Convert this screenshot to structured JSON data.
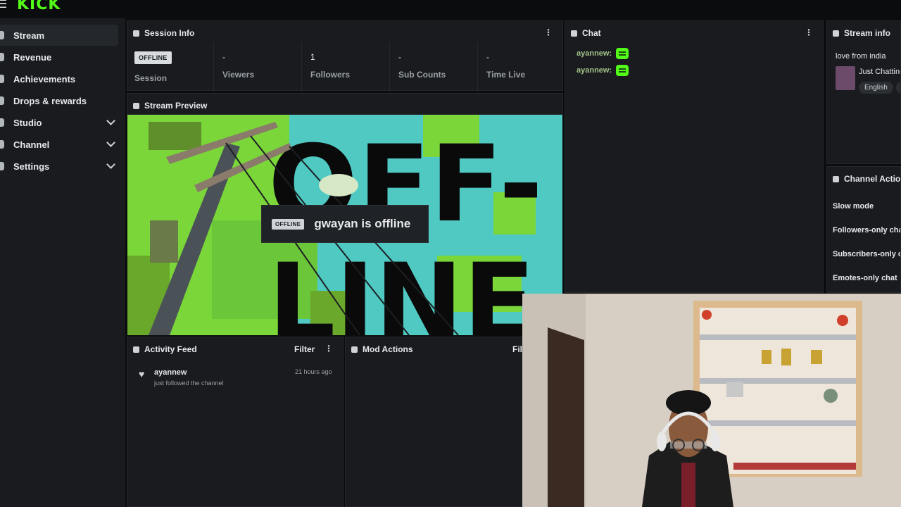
{
  "app": {
    "logo": "KICK"
  },
  "sidebar": {
    "items": [
      {
        "label": "Stream",
        "active": true
      },
      {
        "label": "Revenue"
      },
      {
        "label": "Achievements"
      },
      {
        "label": "Drops & rewards"
      },
      {
        "label": "Studio",
        "expandable": true
      },
      {
        "label": "Channel",
        "expandable": true
      },
      {
        "label": "Settings",
        "expandable": true
      }
    ]
  },
  "session": {
    "title": "Session Info",
    "status_badge": "OFFLINE",
    "session_label": "Session",
    "stats": [
      {
        "value": "-",
        "label": "Viewers"
      },
      {
        "value": "1",
        "label": "Followers"
      },
      {
        "value": "-",
        "label": "Sub Counts"
      },
      {
        "value": "-",
        "label": "Time Live"
      }
    ]
  },
  "preview": {
    "title": "Stream Preview",
    "badge": "OFFLINE",
    "message": "gwayan is offline",
    "bg_word_1": "OFF-",
    "bg_word_2": "LINE"
  },
  "activity": {
    "title": "Activity Feed",
    "filter": "Filter",
    "items": [
      {
        "user": "ayannew",
        "text": "just followed the channel",
        "time": "21 hours ago"
      }
    ]
  },
  "mod": {
    "title": "Mod Actions",
    "filter": "Filter"
  },
  "chat": {
    "title": "Chat",
    "messages": [
      {
        "user": "ayannew:"
      },
      {
        "user": "ayannew:"
      }
    ]
  },
  "stream_info": {
    "title": "Stream info",
    "stream_title": "love from india",
    "category": "Just Chatting",
    "tags": [
      "English",
      "c"
    ]
  },
  "channel_actions": {
    "title": "Channel Actions",
    "items": [
      "Slow mode",
      "Followers-only chat",
      "Subscribers-only chat",
      "Emotes-only chat"
    ]
  },
  "colors": {
    "brand": "#53fc18",
    "panel": "#191b1f",
    "background": "#0b0c0d"
  }
}
